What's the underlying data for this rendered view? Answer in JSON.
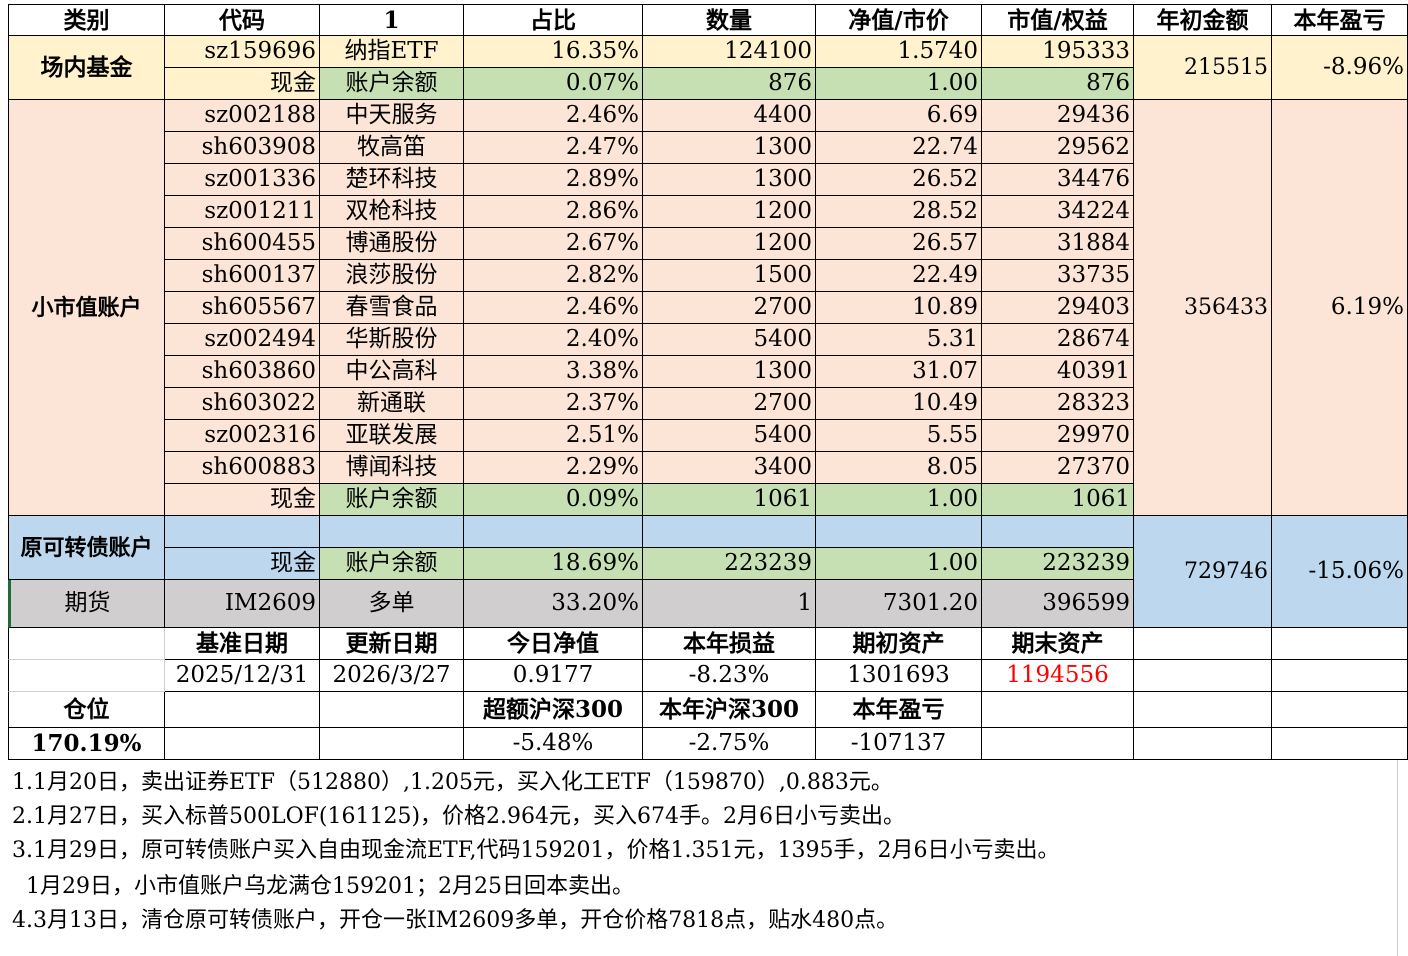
{
  "header": [
    "类别",
    "代码",
    "1",
    "占比",
    "数量",
    "净值/市价",
    "市值/权益",
    "年初金额",
    "本年盈亏"
  ],
  "fund": {
    "category": "场内基金",
    "rows": [
      {
        "code": "sz159696",
        "name": "纳指ETF",
        "ratio": "16.35%",
        "qty": "124100",
        "price": "1.5740",
        "value": "195333"
      },
      {
        "code": "现金",
        "name": "账户余额",
        "ratio": "0.07%",
        "qty": "876",
        "price": "1.00",
        "value": "876"
      }
    ],
    "start_amount": "215515",
    "pnl": "-8.96%"
  },
  "small_cap": {
    "category": "小市值账户",
    "rows": [
      {
        "code": "sz002188",
        "name": "中天服务",
        "ratio": "2.46%",
        "qty": "4400",
        "price": "6.69",
        "value": "29436"
      },
      {
        "code": "sh603908",
        "name": "牧高笛",
        "ratio": "2.47%",
        "qty": "1300",
        "price": "22.74",
        "value": "29562"
      },
      {
        "code": "sz001336",
        "name": "楚环科技",
        "ratio": "2.89%",
        "qty": "1300",
        "price": "26.52",
        "value": "34476"
      },
      {
        "code": "sz001211",
        "name": "双枪科技",
        "ratio": "2.86%",
        "qty": "1200",
        "price": "28.52",
        "value": "34224"
      },
      {
        "code": "sh600455",
        "name": "博通股份",
        "ratio": "2.67%",
        "qty": "1200",
        "price": "26.57",
        "value": "31884"
      },
      {
        "code": "sh600137",
        "name": "浪莎股份",
        "ratio": "2.82%",
        "qty": "1500",
        "price": "22.49",
        "value": "33735"
      },
      {
        "code": "sh605567",
        "name": "春雪食品",
        "ratio": "2.46%",
        "qty": "2700",
        "price": "10.89",
        "value": "29403"
      },
      {
        "code": "sz002494",
        "name": "华斯股份",
        "ratio": "2.40%",
        "qty": "5400",
        "price": "5.31",
        "value": "28674"
      },
      {
        "code": "sh603860",
        "name": "中公高科",
        "ratio": "3.38%",
        "qty": "1300",
        "price": "31.07",
        "value": "40391"
      },
      {
        "code": "sh603022",
        "name": "新通联",
        "ratio": "2.37%",
        "qty": "2700",
        "price": "10.49",
        "value": "28323"
      },
      {
        "code": "sz002316",
        "name": "亚联发展",
        "ratio": "2.51%",
        "qty": "5400",
        "price": "5.55",
        "value": "29970"
      },
      {
        "code": "sh600883",
        "name": "博闻科技",
        "ratio": "2.29%",
        "qty": "3400",
        "price": "8.05",
        "value": "27370"
      },
      {
        "code": "现金",
        "name": "账户余额",
        "ratio": "0.09%",
        "qty": "1061",
        "price": "1.00",
        "value": "1061"
      }
    ],
    "start_amount": "356433",
    "pnl": "6.19%"
  },
  "convertible": {
    "category": "原可转债账户",
    "cash": {
      "code": "现金",
      "name": "账户余额",
      "ratio": "18.69%",
      "qty": "223239",
      "price": "1.00",
      "value": "223239"
    },
    "start_amount": "729746",
    "pnl": "-15.06%"
  },
  "futures": {
    "category": "期货",
    "code": "IM2609",
    "name": "多单",
    "ratio": "33.20%",
    "qty": "1",
    "price": "7301.20",
    "value": "396599"
  },
  "summary": {
    "labels1": [
      "基准日期",
      "更新日期",
      "今日净值",
      "本年损益",
      "期初资产",
      "期末资产"
    ],
    "values1": [
      "2025/12/31",
      "2026/3/27",
      "0.9177",
      "-8.23%",
      "1301693",
      "1194556"
    ],
    "position_label": "仓位",
    "position_value": "170.19%",
    "labels2": [
      "超额沪深300",
      "本年沪深300",
      "本年盈亏"
    ],
    "values2": [
      "-5.48%",
      "-2.75%",
      "-107137"
    ]
  },
  "notes": [
    "1.1月20日，卖出证券ETF（512880）,1.205元，买入化工ETF（159870）,0.883元。",
    "2.1月27日，买入标普500LOF(161125)，价格2.964元，买入674手。2月6日小亏卖出。",
    "3.1月29日，原可转债账户买入自由现金流ETF,代码159201，价格1.351元，1395手，2月6日小亏卖出。",
    "  1月29日，小市值账户乌龙满仓159201；2月25日回本卖出。",
    "4.3月13日，清仓原可转债账户，开仓一张IM2609多单，开仓价格7818点，贴水480点。"
  ],
  "colors": {
    "yellow": "#fff2cc",
    "pink": "#fce4d6",
    "green": "#c6e0b4",
    "blue": "#bdd7ee",
    "gray": "#d0cece",
    "red": "#ff0000"
  }
}
